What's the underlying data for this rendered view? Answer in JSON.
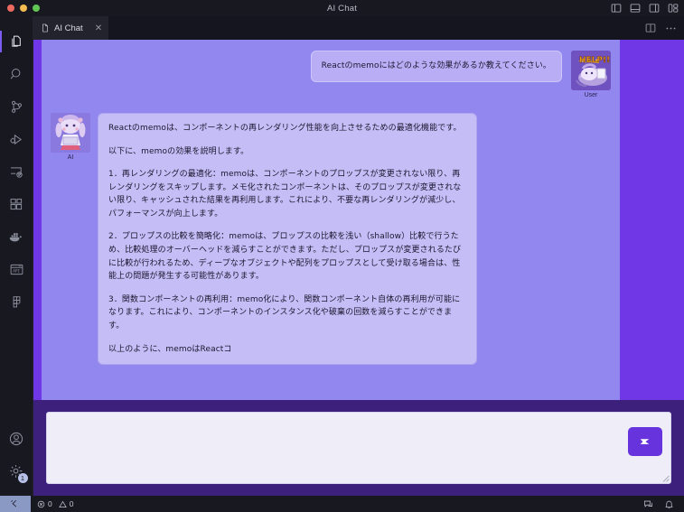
{
  "window": {
    "title": "AI Chat",
    "traffic_lights": [
      "close",
      "minimize",
      "zoom"
    ],
    "actions": [
      {
        "name": "toggle-primary-sidebar-icon",
        "label": "Toggle Primary Side Bar"
      },
      {
        "name": "toggle-panel-icon",
        "label": "Toggle Panel"
      },
      {
        "name": "toggle-secondary-sidebar-icon",
        "label": "Toggle Secondary Side Bar"
      },
      {
        "name": "customize-layout-icon",
        "label": "Customize Layout"
      }
    ]
  },
  "activitybar": {
    "items": [
      {
        "name": "explorer",
        "label": "Explorer"
      },
      {
        "name": "search",
        "label": "Search"
      },
      {
        "name": "source-control",
        "label": "Source Control"
      },
      {
        "name": "run-and-debug",
        "label": "Run and Debug"
      },
      {
        "name": "remote-explorer",
        "label": "Remote Explorer"
      },
      {
        "name": "extensions",
        "label": "Extensions"
      },
      {
        "name": "docker",
        "label": "Docker"
      },
      {
        "name": "api",
        "label": "API"
      },
      {
        "name": "figma",
        "label": "Figma"
      }
    ],
    "bottom": [
      {
        "name": "accounts",
        "label": "Accounts"
      },
      {
        "name": "settings",
        "label": "Manage",
        "badge": "1"
      }
    ]
  },
  "tabbar": {
    "tabs": [
      {
        "label": "AI Chat",
        "icon": "file-icon",
        "close": "✕",
        "active": true
      }
    ],
    "actions": [
      {
        "name": "split-editor-icon",
        "label": "Split Editor"
      },
      {
        "name": "more-actions-icon",
        "label": "More Actions..."
      }
    ]
  },
  "chat": {
    "messages": [
      {
        "role": "user",
        "author": "User",
        "avatar": "user-avatar-anime-help",
        "text": "Reactのmemoにはどのような効果があるか教えてください。"
      },
      {
        "role": "ai",
        "author": "AI",
        "avatar": "ai-avatar-anime-chibi",
        "paragraphs": [
          "Reactのmemoは、コンポーネントの再レンダリング性能を向上させるための最適化機能です。",
          "以下に、memoの効果を説明します。",
          "1．再レンダリングの最適化：memoは、コンポーネントのプロップスが変更されない限り、再レンダリングをスキップします。メモ化されたコンポーネントは、そのプロップスが変更されない限り、キャッシュされた結果を再利用します。これにより、不要な再レンダリングが減少し、パフォーマンスが向上します。",
          "2．プロップスの比較を簡略化：memoは、プロップスの比較を浅い（shallow）比較で行うため、比較処理のオーバーヘッドを減らすことができます。ただし、プロップスが変更されるたびに比較が行われるため、ディープなオブジェクトや配列をプロップスとして受け取る場合は、性能上の問題が発生する可能性があります。",
          "3．関数コンポーネントの再利用：memo化により、関数コンポーネント自体の再利用が可能になります。これにより、コンポーネントのインスタンス化や破棄の回数を減らすことができます。",
          "以上のように、memoはReactコ"
        ]
      }
    ]
  },
  "composer": {
    "value": "",
    "placeholder": "",
    "send_label": "Send",
    "send_icon": "paper-plane-icon"
  },
  "statusbar": {
    "remote_label": "",
    "errors": "0",
    "warnings": "0",
    "right": [
      {
        "name": "feedback-icon",
        "label": "Tweet Feedback"
      },
      {
        "name": "notifications-bell-icon",
        "label": "Notifications"
      }
    ]
  },
  "colors": {
    "chat_bg": "#9287ef",
    "chat_band": "#6f37e6",
    "composer_bg": "#3d1f7c",
    "user_bubble": "#b9aef5",
    "ai_bubble": "#c5bdf5",
    "send_button": "#6633dd",
    "editor_bg": "#15151f",
    "chrome_bg": "#181821"
  }
}
